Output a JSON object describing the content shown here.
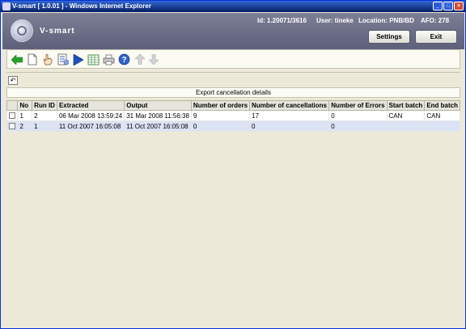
{
  "window": {
    "title": "V-smart [ 1.0.01 ] - Windows Internet Explorer"
  },
  "header": {
    "logo_text": "V-smart",
    "id_info": "Id: 1.20071/3616",
    "user_info": "User: tineke",
    "location_info": "Location: PNB/BD",
    "afo_info": "AFO: 278",
    "settings_label": "Settings",
    "exit_label": "Exit"
  },
  "toolbar": {
    "icons": [
      "back-arrow-icon",
      "new-document-icon",
      "select-hand-icon",
      "details-list-icon",
      "run-play-icon",
      "spreadsheet-icon",
      "print-icon",
      "help-icon",
      "move-up-icon",
      "move-down-icon"
    ]
  },
  "main": {
    "caption": "Export cancellation details",
    "columns": [
      "",
      "No",
      "Run ID",
      "Extracted",
      "Output",
      "Number of orders",
      "Number of cancellations",
      "Number of Errors",
      "Start batch",
      "End batch"
    ],
    "rows": [
      {
        "no": "1",
        "run_id": "2",
        "extracted": "06 Mar 2008 13:59:24",
        "output": "31 Mar 2008 11:56:38",
        "orders": "9",
        "cancellations": "17",
        "errors": "0",
        "start_batch": "CAN",
        "end_batch": "CAN"
      },
      {
        "no": "2",
        "run_id": "1",
        "extracted": "11 Oct 2007 16:05:08",
        "output": "11 Oct 2007 16:05:08",
        "orders": "0",
        "cancellations": "0",
        "errors": "0",
        "start_batch": "",
        "end_batch": ""
      }
    ]
  },
  "colors": {
    "titlebar": "#0a246a",
    "header": "#6e7089",
    "row_selected": "#dbe2f3",
    "background": "#ece9d8"
  }
}
